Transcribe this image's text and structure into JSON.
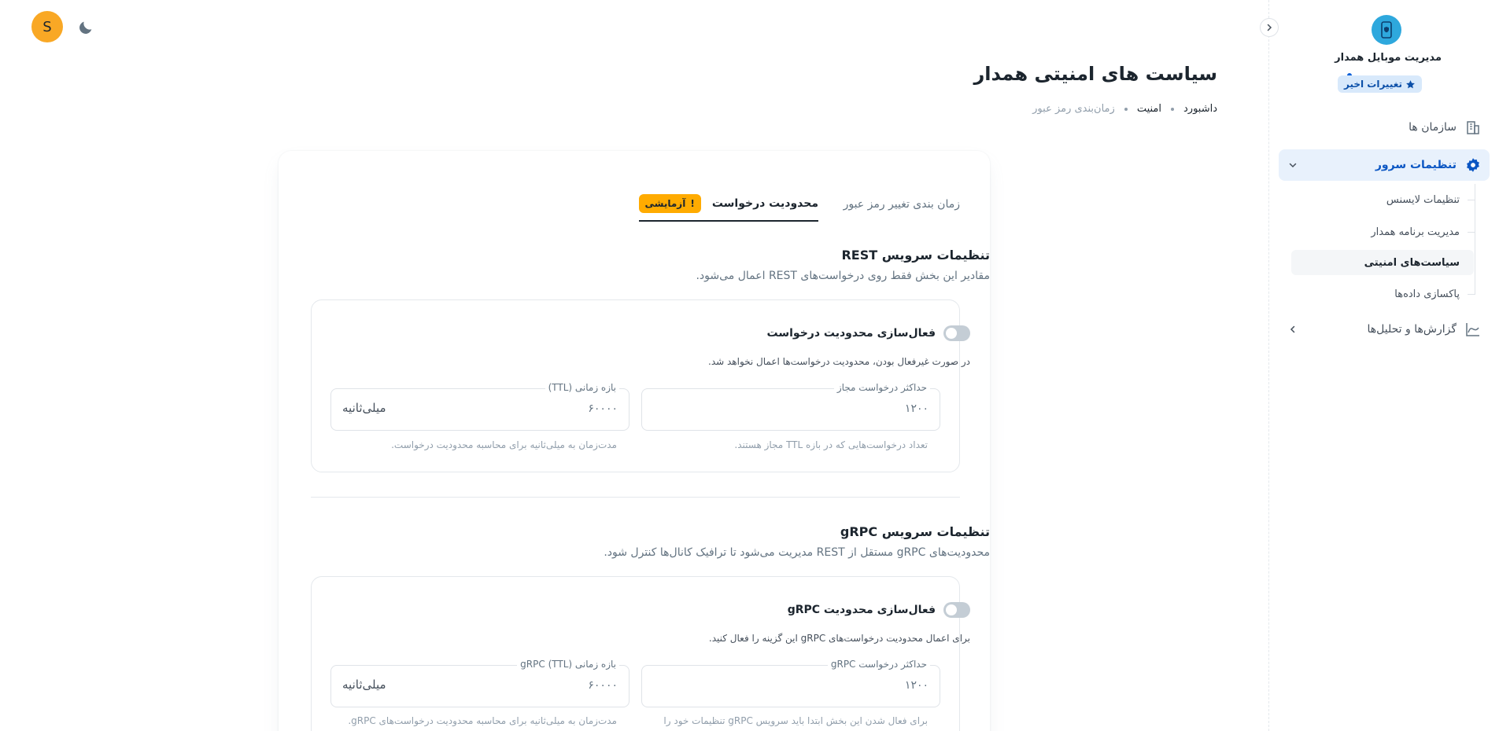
{
  "app": {
    "title": "مدیریت موبایل همدار",
    "recent_changes": "تغییرات اخیر"
  },
  "user": {
    "initial": "S"
  },
  "sidebar": {
    "items": [
      {
        "label": "سازمان ها"
      },
      {
        "label": "تنظیمات سرور"
      },
      {
        "label": "گزارش‌ها و تحلیل‌ها"
      }
    ],
    "subitems": [
      {
        "label": "تنظیمات لایسنس"
      },
      {
        "label": "مدیریت برنامه همدار"
      },
      {
        "label": "سیاست‌های امنیتی"
      },
      {
        "label": "پاکسازی داده‌ها"
      }
    ]
  },
  "header": {
    "title": "سیاست های امنیتی همدار",
    "breadcrumb": [
      "داشبورد",
      "امنیت",
      "زمان‌بندی رمز عبور"
    ]
  },
  "tabs": [
    {
      "label": "زمان بندی تغییر رمز عبور"
    },
    {
      "label": "محدودیت درخواست",
      "badge": "آزمایشی",
      "badge_icon": "!"
    }
  ],
  "rest": {
    "title": "تنظیمات سرویس REST",
    "desc": "مقادیر این بخش فقط روی درخواست‌های REST اعمال می‌شود.",
    "toggle_label": "فعال‌سازی محدودیت درخواست",
    "toggle_help": "در صورت غیرفعال بودن، محدودیت درخواست‌ها اعمال نخواهد شد.",
    "max_label": "حداکثر درخواست مجاز",
    "max_value": "۱۲۰۰",
    "max_help": "تعداد درخواست‌هایی که در بازه TTL مجاز هستند.",
    "ttl_label": "بازه زمانی (TTL)",
    "ttl_value": "۶۰۰۰۰",
    "ttl_unit": "میلی‌ثانیه",
    "ttl_help": "مدت‌زمان به میلی‌ثانیه برای محاسبه محدودیت درخواست."
  },
  "grpc": {
    "title": "تنظیمات سرویس gRPC",
    "desc": "محدودیت‌های gRPC مستقل از REST مدیریت می‌شود تا ترافیک کانال‌ها کنترل شود.",
    "toggle_label": "فعال‌سازی محدودیت gRPC",
    "toggle_help": "برای اعمال محدودیت درخواست‌های gRPC این گزینه را فعال کنید.",
    "max_label": "حداکثر درخواست gRPC",
    "max_value": "۱۲۰۰",
    "max_help": "برای فعال شدن این بخش ابتدا باید سرویس gRPC تنظیمات خود را",
    "ttl_label": "بازه زمانی (TTL) gRPC",
    "ttl_value": "۶۰۰۰۰",
    "ttl_unit": "میلی‌ثانیه",
    "ttl_help": "مدت‌زمان به میلی‌ثانیه برای محاسبه محدودیت درخواست‌های gRPC."
  },
  "colors": {
    "accent": "#0b56c3",
    "avatar": "#f9a825",
    "beta": "#ffab00",
    "logo": "#2ea8dd"
  }
}
